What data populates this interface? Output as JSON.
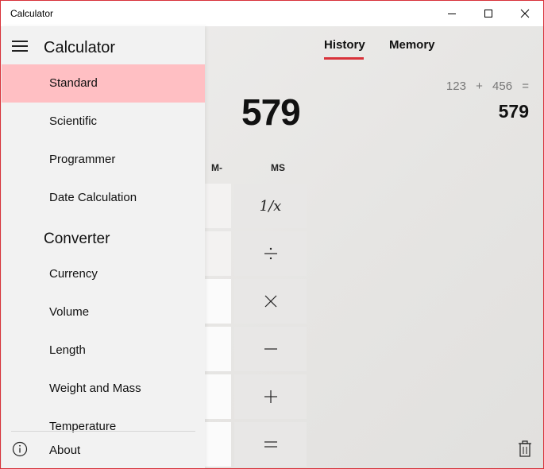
{
  "window": {
    "title": "Calculator",
    "accent_color": "#d8323a"
  },
  "tabs": [
    {
      "label": "History",
      "selected": true
    },
    {
      "label": "Memory",
      "selected": false
    }
  ],
  "history": {
    "operand1": "123",
    "operator": "+",
    "operand2": "456",
    "equals": "=",
    "result": "579"
  },
  "display": {
    "value": "579"
  },
  "memory_buttons": [
    "M-",
    "MS"
  ],
  "keys": {
    "reciprocal": "1/x",
    "divide_icon": "divide-icon",
    "multiply_icon": "multiply-icon",
    "minus_icon": "minus-icon",
    "plus_icon": "plus-icon",
    "equals_icon": "equals-icon"
  },
  "nav": {
    "title": "Calculator",
    "calculator_items": [
      {
        "label": "Standard",
        "selected": true
      },
      {
        "label": "Scientific"
      },
      {
        "label": "Programmer"
      },
      {
        "label": "Date Calculation"
      }
    ],
    "converter_header": "Converter",
    "converter_items": [
      {
        "label": "Currency"
      },
      {
        "label": "Volume"
      },
      {
        "label": "Length"
      },
      {
        "label": "Weight and Mass"
      },
      {
        "label": "Temperature"
      }
    ],
    "about_label": "About",
    "selected_color": "#ffbfc3"
  }
}
